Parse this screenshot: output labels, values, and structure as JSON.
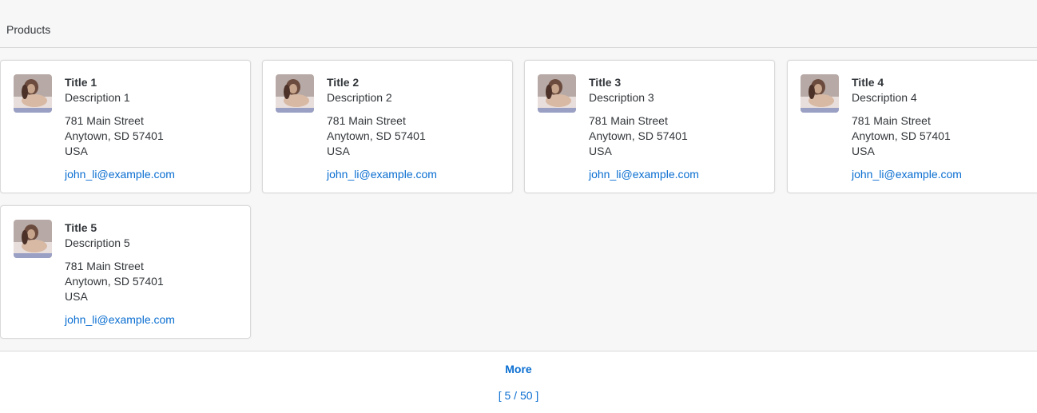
{
  "header": {
    "title": "Products"
  },
  "cards": [
    {
      "title": "Title 1",
      "description": "Description 1",
      "street": "781 Main Street",
      "city": "Anytown, SD 57401",
      "country": "USA",
      "email": "john_li@example.com",
      "image_icon": "dog-photo"
    },
    {
      "title": "Title 2",
      "description": "Description 2",
      "street": "781 Main Street",
      "city": "Anytown, SD 57401",
      "country": "USA",
      "email": "john_li@example.com",
      "image_icon": "dog-photo"
    },
    {
      "title": "Title 3",
      "description": "Description 3",
      "street": "781 Main Street",
      "city": "Anytown, SD 57401",
      "country": "USA",
      "email": "john_li@example.com",
      "image_icon": "dog-photo"
    },
    {
      "title": "Title 4",
      "description": "Description 4",
      "street": "781 Main Street",
      "city": "Anytown, SD 57401",
      "country": "USA",
      "email": "john_li@example.com",
      "image_icon": "dog-photo"
    },
    {
      "title": "Title 5",
      "description": "Description 5",
      "street": "781 Main Street",
      "city": "Anytown, SD 57401",
      "country": "USA",
      "email": "john_li@example.com",
      "image_icon": "dog-photo"
    }
  ],
  "footer": {
    "more_label": "More",
    "count_label": "[ 5 / 50 ]"
  },
  "colors": {
    "link": "#0a6ed1",
    "text": "#32363a",
    "background": "#f7f7f7",
    "card": "#ffffff",
    "border": "#d9d9d9"
  }
}
